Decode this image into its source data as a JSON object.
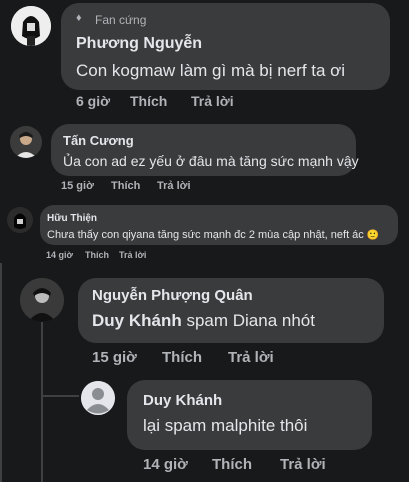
{
  "comments": [
    {
      "badge_icon": "diamond-icon",
      "badge": "Fan cứng",
      "name": "Phương Nguyễn",
      "text": "Con kogmaw làm gì mà bị nerf ta ơi",
      "time": "6 giờ",
      "like": "Thích",
      "reply": "Trả lời"
    },
    {
      "name": "Tấn Cương",
      "text": "Ủa con ad ez yếu ở đâu mà tăng sức mạnh vậy",
      "time": "15 giờ",
      "like": "Thích",
      "reply": "Trả lời"
    },
    {
      "name": "Hữu Thiện",
      "text": "Chưa thấy con qiyana tăng sức mạnh đc 2 mùa cập nhật, neft ác",
      "emoji": "🙂",
      "time": "14 giờ",
      "like": "Thích",
      "reply": "Trả lời"
    },
    {
      "name": "Nguyễn Phượng Quân",
      "text_mention": "Duy Khánh",
      "text_rest": " spam Diana nhót",
      "time": "15 giờ",
      "like": "Thích",
      "reply": "Trả lời"
    },
    {
      "name": "Duy Khánh",
      "text": "lại spam malphite thôi",
      "time": "14 giờ",
      "like": "Thích",
      "reply": "Trả lời"
    }
  ],
  "colors": {
    "background": "#18191a",
    "bubble": "#3a3b3c",
    "text": "#e4e6eb",
    "meta": "#b0b3b8"
  }
}
